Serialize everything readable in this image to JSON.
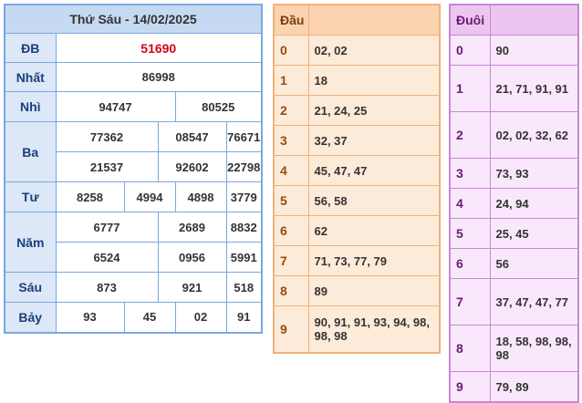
{
  "results": {
    "title": "Thứ Sáu - 14/02/2025",
    "rows": [
      {
        "label": "ĐB",
        "values": [
          "51690"
        ]
      },
      {
        "label": "Nhất",
        "values": [
          "86998"
        ]
      },
      {
        "label": "Nhì",
        "values": [
          "94747",
          "80525"
        ]
      },
      {
        "label": "Ba",
        "values": [
          "77362",
          "08547",
          "76671",
          "21537",
          "92602",
          "22798"
        ]
      },
      {
        "label": "Tư",
        "values": [
          "8258",
          "4994",
          "4898",
          "3779"
        ]
      },
      {
        "label": "Năm",
        "values": [
          "6777",
          "2689",
          "8832",
          "6524",
          "0956",
          "5991"
        ]
      },
      {
        "label": "Sáu",
        "values": [
          "873",
          "921",
          "518"
        ]
      },
      {
        "label": "Bảy",
        "values": [
          "93",
          "45",
          "02",
          "91"
        ]
      }
    ]
  },
  "dau": {
    "header": "Đầu",
    "rows": [
      {
        "k": "0",
        "v": "02, 02"
      },
      {
        "k": "1",
        "v": "18"
      },
      {
        "k": "2",
        "v": "21, 24, 25"
      },
      {
        "k": "3",
        "v": "32, 37"
      },
      {
        "k": "4",
        "v": "45, 47, 47"
      },
      {
        "k": "5",
        "v": "56, 58"
      },
      {
        "k": "6",
        "v": "62"
      },
      {
        "k": "7",
        "v": "71, 73, 77, 79"
      },
      {
        "k": "8",
        "v": "89"
      },
      {
        "k": "9",
        "v": "90, 91, 91, 93, 94, 98, 98, 98"
      }
    ]
  },
  "duoi": {
    "header": "Đuôi",
    "rows": [
      {
        "k": "0",
        "v": "90"
      },
      {
        "k": "1",
        "v": "21, 71, 91, 91"
      },
      {
        "k": "2",
        "v": "02, 02, 32, 62"
      },
      {
        "k": "3",
        "v": "73, 93"
      },
      {
        "k": "4",
        "v": "24, 94"
      },
      {
        "k": "5",
        "v": "25, 45"
      },
      {
        "k": "6",
        "v": "56"
      },
      {
        "k": "7",
        "v": "37, 47, 47, 77"
      },
      {
        "k": "8",
        "v": "18, 58, 98, 98, 98"
      },
      {
        "k": "9",
        "v": "79, 89"
      }
    ]
  }
}
